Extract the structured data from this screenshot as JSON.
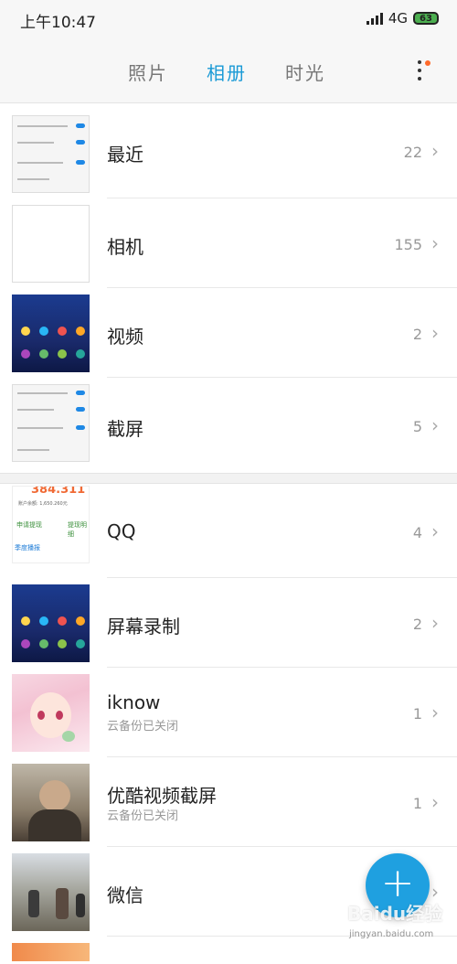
{
  "status_bar": {
    "time": "上午10:47",
    "network": "4G",
    "battery": "63"
  },
  "tabs": [
    {
      "label": "照片",
      "active": false
    },
    {
      "label": "相册",
      "active": true
    },
    {
      "label": "时光",
      "active": false
    }
  ],
  "albums": [
    {
      "title": "最近",
      "count": "22",
      "thumb": "settings-screenshot"
    },
    {
      "title": "相机",
      "count": "155",
      "thumb": "blank"
    },
    {
      "title": "视频",
      "count": "2",
      "thumb": "phone-homescreen"
    },
    {
      "title": "截屏",
      "count": "5",
      "thumb": "settings-screenshot"
    },
    {
      "title": "QQ",
      "count": "4",
      "thumb": "qq-screenshot",
      "qq_amount": "384.311",
      "qq_line": "账户余额: 1,650.260元",
      "qq_link_left": "申请提现",
      "qq_link_right": "提现明细",
      "qq_bottom": "季度播报"
    },
    {
      "title": "屏幕录制",
      "count": "2",
      "thumb": "phone-homescreen"
    },
    {
      "title": "iknow",
      "subtitle": "云备份已关闭",
      "count": "1",
      "thumb": "anime-girl"
    },
    {
      "title": "优酷视频截屏",
      "subtitle": "云备份已关闭",
      "count": "1",
      "thumb": "video-frame"
    },
    {
      "title": "微信",
      "count": "",
      "thumb": "street-photo"
    }
  ],
  "fab": {
    "icon": "plus-icon"
  },
  "watermark": {
    "brand": "Baidu经验",
    "url": "jingyan.baidu.com"
  },
  "colors": {
    "accent": "#1a9ad6",
    "fab": "#1fa0e0",
    "badge_dot": "#ff6a2a"
  }
}
